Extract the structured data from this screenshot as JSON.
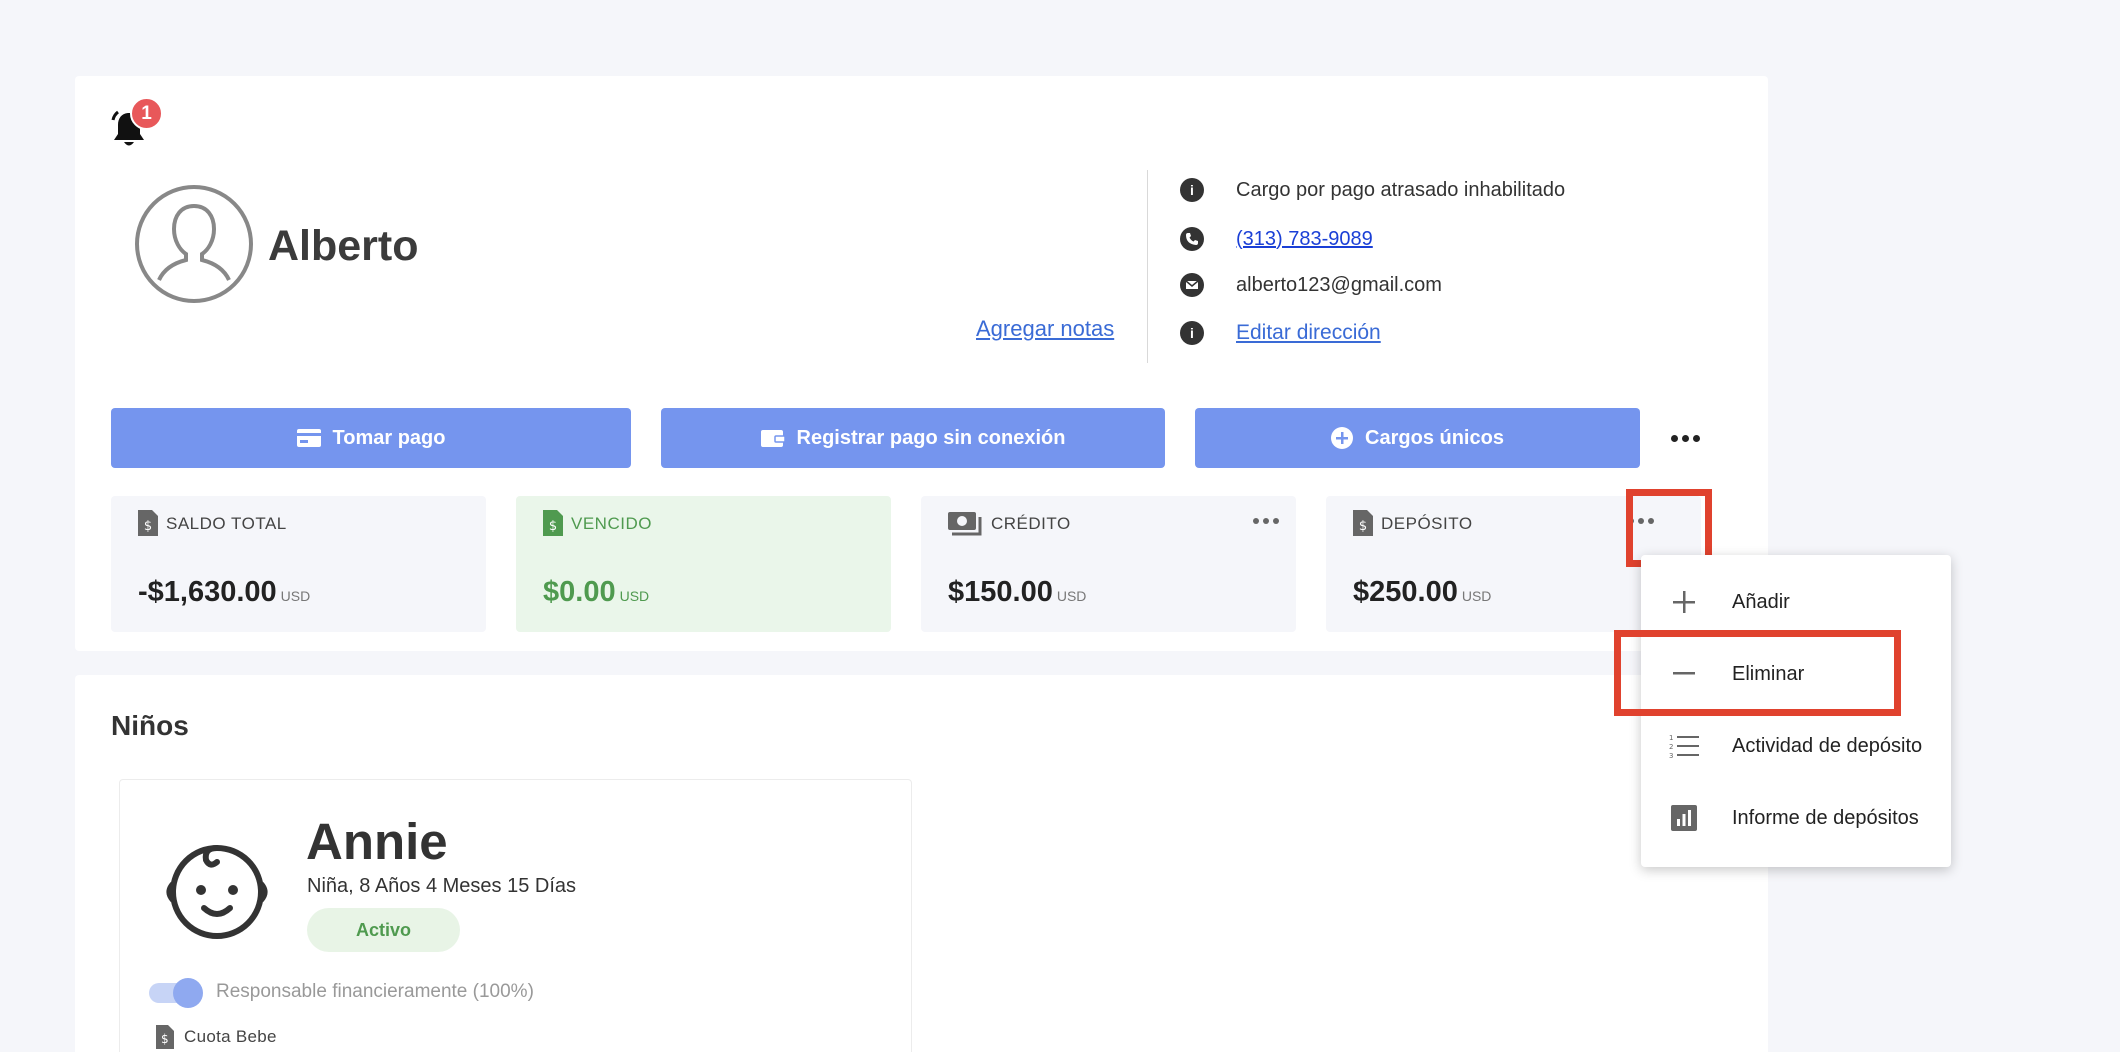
{
  "notifications": {
    "count": "1"
  },
  "parent": {
    "name": "Alberto",
    "add_notes_label": "Agregar notas",
    "info": {
      "late_fee": "Cargo por pago atrasado inhabilitado",
      "phone": "(313) 783-9089",
      "email": "alberto123@gmail.com",
      "edit_address": "Editar dirección"
    }
  },
  "actions": {
    "take_payment": "Tomar pago",
    "offline_payment": "Registrar pago sin conexión",
    "one_time_charges": "Cargos únicos"
  },
  "balances": [
    {
      "label": "SALDO TOTAL",
      "amount": "-$1,630.00",
      "currency": "USD"
    },
    {
      "label": "VENCIDO",
      "amount": "$0.00",
      "currency": "USD"
    },
    {
      "label": "CRÉDITO",
      "amount": "$150.00",
      "currency": "USD"
    },
    {
      "label": "DEPÓSITO",
      "amount": "$250.00",
      "currency": "USD"
    }
  ],
  "deposit_menu": {
    "items": [
      {
        "label": "Añadir",
        "icon": "plus-icon"
      },
      {
        "label": "Eliminar",
        "icon": "minus-icon"
      },
      {
        "label": "Actividad de depósito",
        "icon": "numbered-list-icon"
      },
      {
        "label": "Informe de depósitos",
        "icon": "bar-chart-icon"
      }
    ]
  },
  "children_section": {
    "title": "Niños",
    "child": {
      "name": "Annie",
      "details": "Niña, 8 Años 4 Meses 15 Días",
      "status": "Activo",
      "financial_label": "Responsable financieramente (100%)",
      "fee_label": "Cuota Bebe"
    }
  },
  "colors": {
    "primary_button": "#7595ee",
    "highlight": "#e0422e",
    "badge": "#e8585a",
    "overdue_green": "#4f9a4f"
  }
}
